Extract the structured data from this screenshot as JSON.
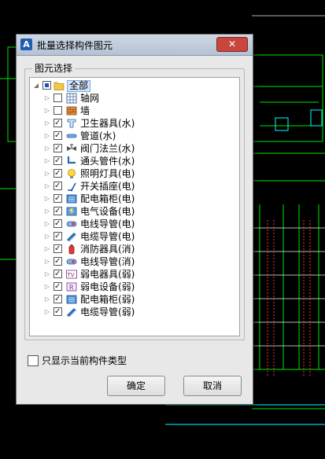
{
  "window": {
    "title": "批量选择构件图元",
    "app_icon": "A",
    "close_symbol": "✕"
  },
  "group": {
    "label": "图元选择"
  },
  "tree": {
    "root": {
      "label": "全部",
      "state": "partial",
      "icon": "folder-icon"
    },
    "items": [
      {
        "label": "轴网",
        "checked": false,
        "icon": "grid-icon"
      },
      {
        "label": "墙",
        "checked": false,
        "icon": "wall-icon"
      },
      {
        "label": "卫生器具(水)",
        "checked": true,
        "icon": "sanitary-fixture-icon"
      },
      {
        "label": "管道(水)",
        "checked": true,
        "icon": "pipe-icon"
      },
      {
        "label": "阀门法兰(水)",
        "checked": true,
        "icon": "valve-icon"
      },
      {
        "label": "通头管件(水)",
        "checked": true,
        "icon": "pipe-fitting-icon"
      },
      {
        "label": "照明灯具(电)",
        "checked": true,
        "icon": "light-bulb-icon"
      },
      {
        "label": "开关插座(电)",
        "checked": true,
        "icon": "switch-icon"
      },
      {
        "label": "配电箱柜(电)",
        "checked": true,
        "icon": "distribution-box-icon"
      },
      {
        "label": "电气设备(电)",
        "checked": true,
        "icon": "electrical-equipment-icon"
      },
      {
        "label": "电线导管(电)",
        "checked": true,
        "icon": "wire-conduit-icon"
      },
      {
        "label": "电缆导管(电)",
        "checked": true,
        "icon": "cable-conduit-icon"
      },
      {
        "label": "消防器具(消)",
        "checked": true,
        "icon": "fire-equipment-icon"
      },
      {
        "label": "电线导管(消)",
        "checked": true,
        "icon": "wire-conduit-icon"
      },
      {
        "label": "弱电器具(弱)",
        "checked": true,
        "icon": "tv-icon"
      },
      {
        "label": "弱电设备(弱)",
        "checked": true,
        "icon": "weak-current-device-icon"
      },
      {
        "label": "配电箱柜(弱)",
        "checked": true,
        "icon": "distribution-box-icon"
      },
      {
        "label": "电缆导管(弱)",
        "checked": true,
        "icon": "cable-conduit-icon"
      }
    ]
  },
  "options": {
    "only_current_type_label": "只显示当前构件类型",
    "only_current_type_checked": false
  },
  "buttons": {
    "ok": "确定",
    "cancel": "取消"
  },
  "colors": {
    "cad_background": "#000000",
    "cad_line": "#00ff00",
    "cad_riser": "#ff3333",
    "cad_accent": "#00ffff"
  }
}
